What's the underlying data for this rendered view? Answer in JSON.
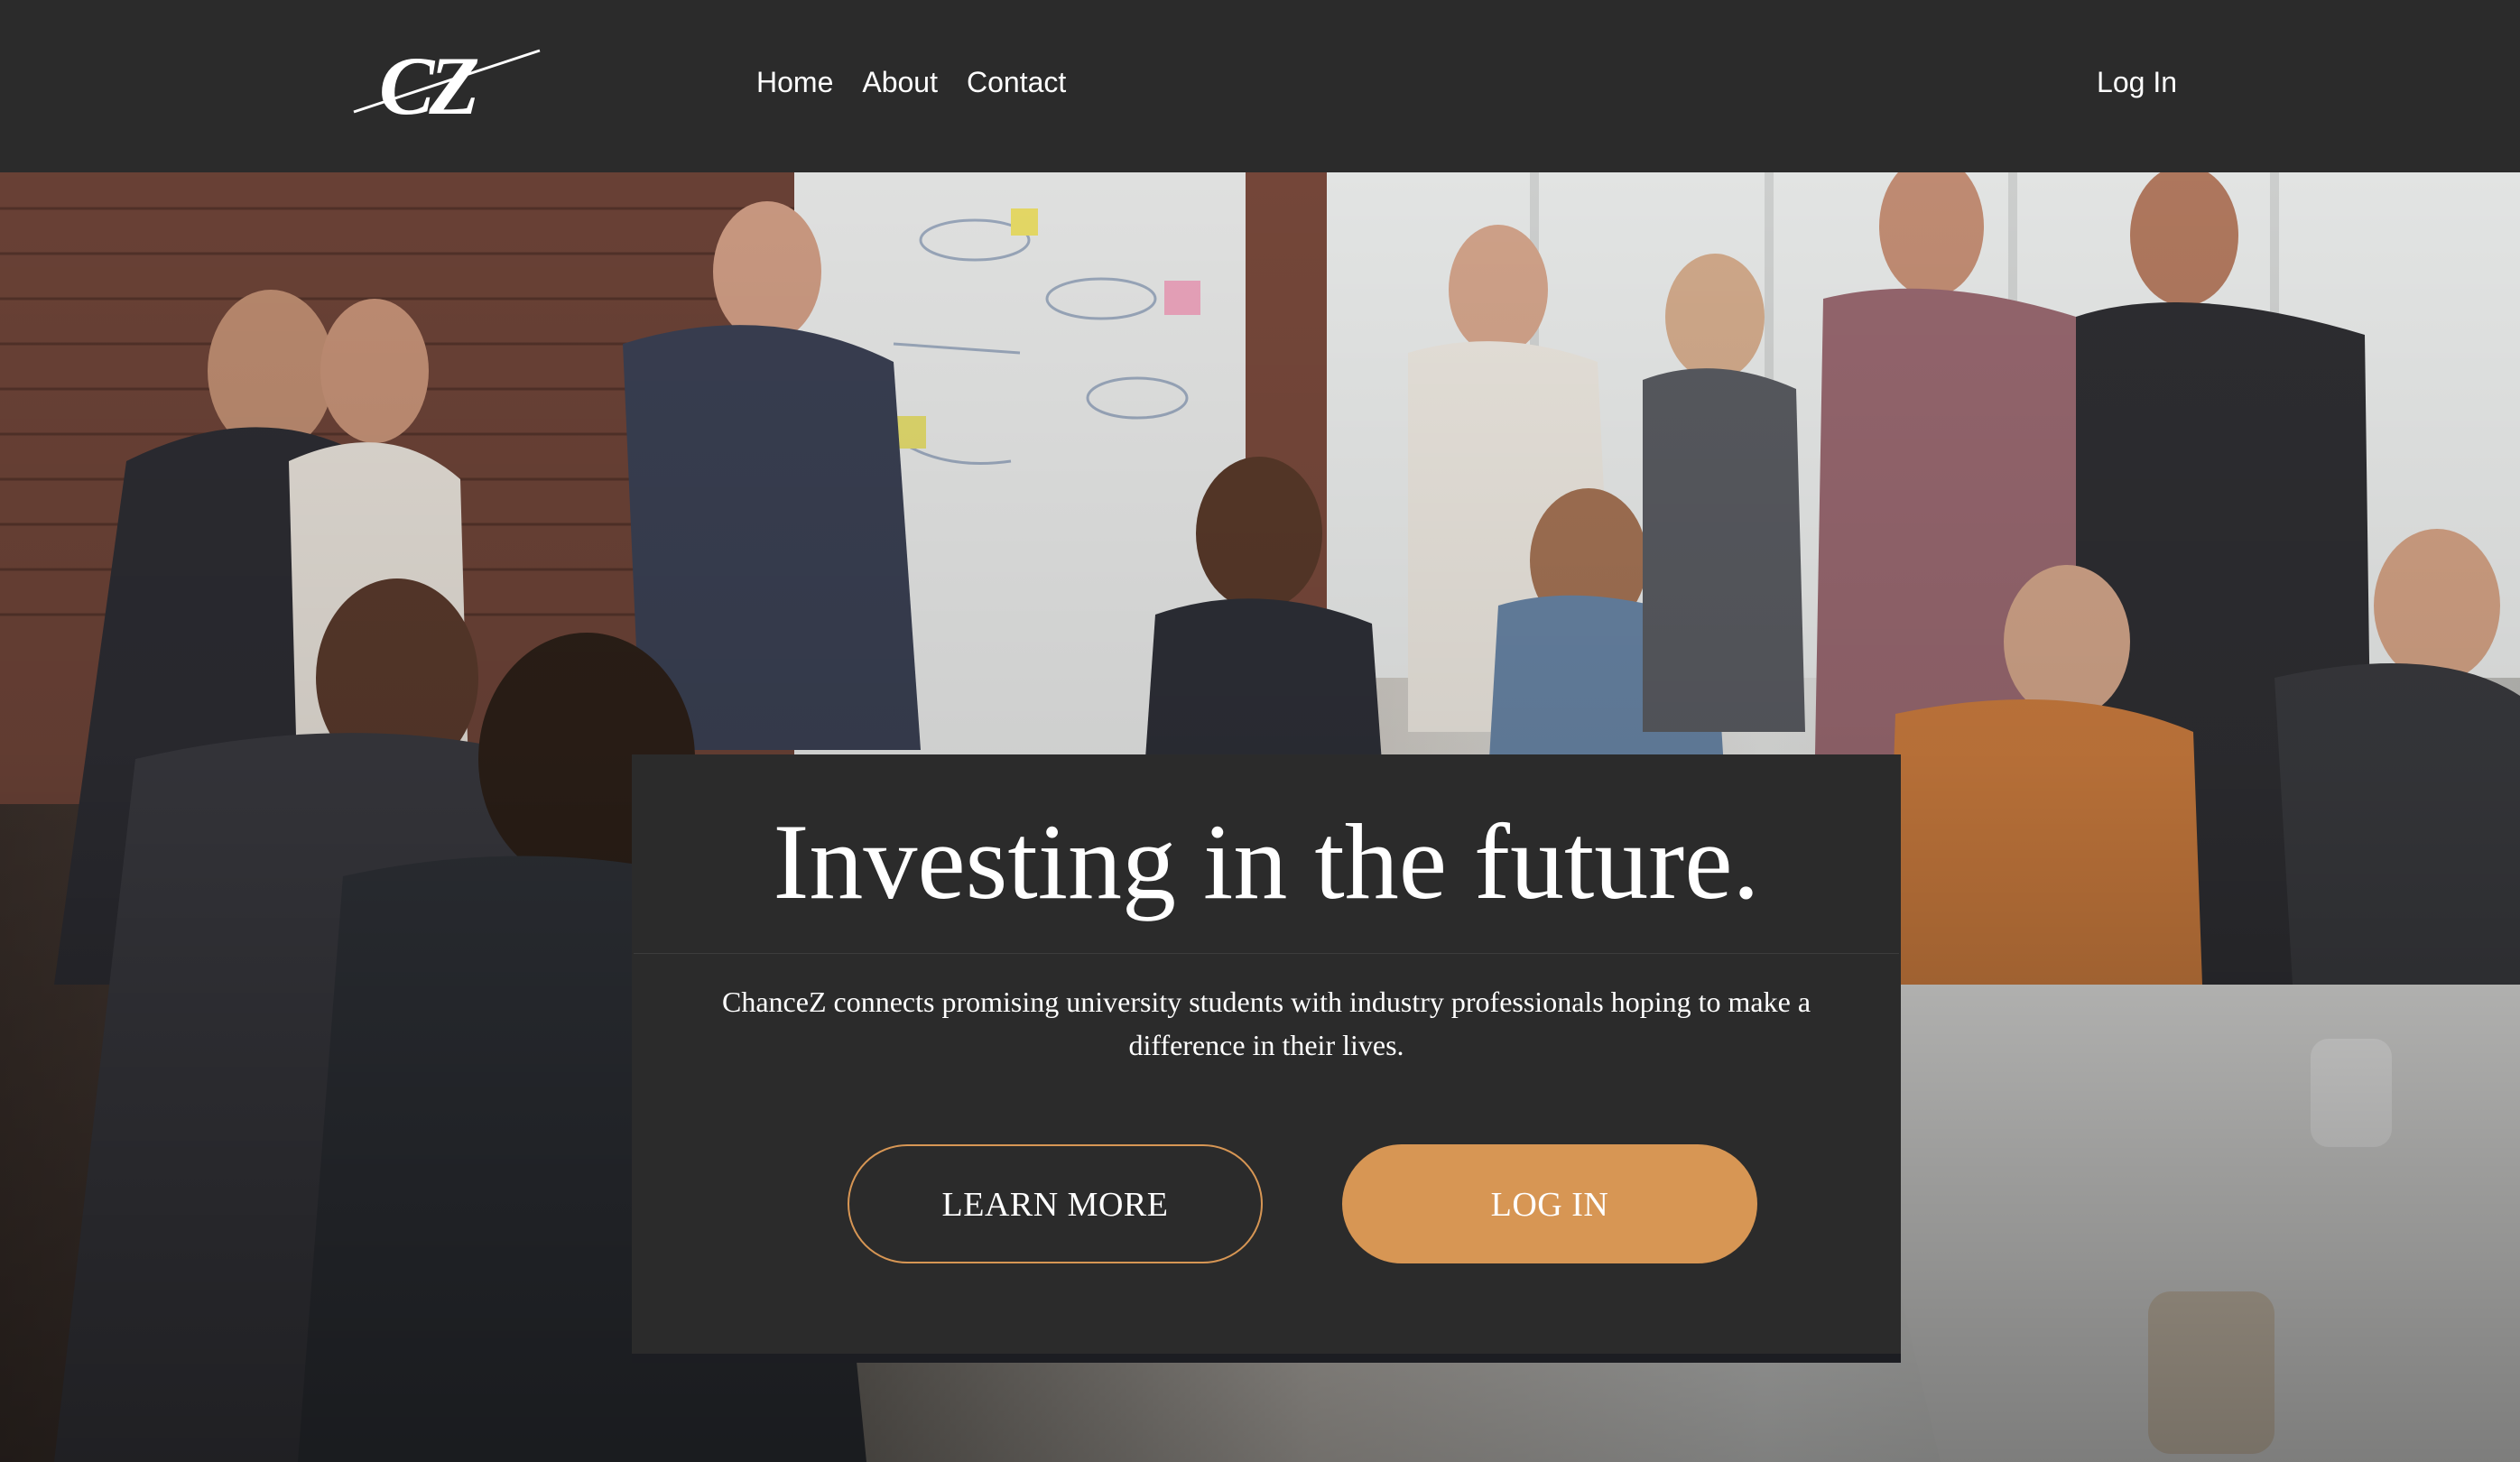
{
  "header": {
    "logo_text": "CZ",
    "nav": [
      {
        "label": "Home"
      },
      {
        "label": "About"
      },
      {
        "label": "Contact"
      }
    ],
    "login_label": "Log In"
  },
  "hero": {
    "title": "Investing in the future.",
    "description": "ChanceZ connects promising university students with industry professionals hoping to make a difference in their lives.",
    "buttons": {
      "learn_more": "LEARN MORE",
      "log_in": "LOG IN"
    }
  },
  "colors": {
    "header_bg": "#2b2b2b",
    "card_bg": "#2b2b2b",
    "accent": "#d79654",
    "text": "#ffffff"
  }
}
